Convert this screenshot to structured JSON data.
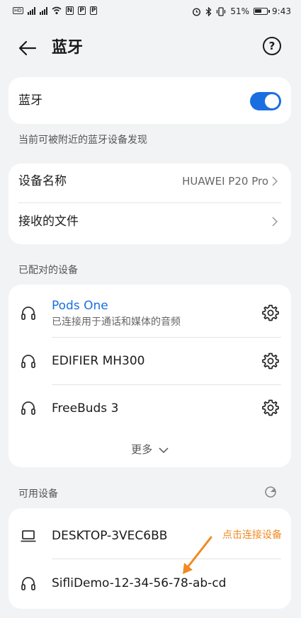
{
  "status_bar": {
    "time": "9:43",
    "battery": "51%"
  },
  "header": {
    "title": "蓝牙"
  },
  "bluetooth_card": {
    "label": "蓝牙",
    "enabled": true
  },
  "discover_note": "当前可被附近的蓝牙设备发现",
  "settings": [
    {
      "label": "设备名称",
      "value": "HUAWEI P20 Pro"
    },
    {
      "label": "接收的文件",
      "value": ""
    }
  ],
  "paired": {
    "label": "已配对的设备",
    "devices": [
      {
        "name": "Pods One",
        "sub": "已连接用于通话和媒体的音频",
        "connected": true,
        "icon": "headset-icon"
      },
      {
        "name": "EDIFIER MH300",
        "sub": "",
        "connected": false,
        "icon": "headset-icon"
      },
      {
        "name": "FreeBuds 3",
        "sub": "",
        "connected": false,
        "icon": "headset-icon"
      }
    ],
    "more_label": "更多"
  },
  "available": {
    "label": "可用设备",
    "devices": [
      {
        "name": "DESKTOP-3VEC6BB",
        "icon": "laptop-icon"
      },
      {
        "name": "SifliDemo-12-34-56-78-ab-cd",
        "icon": "headset-icon"
      }
    ],
    "annotation": "点击连接设备"
  },
  "colors": {
    "accent": "#1a6fe0",
    "annotation": "#f08a24",
    "background": "#f1f3f5"
  }
}
